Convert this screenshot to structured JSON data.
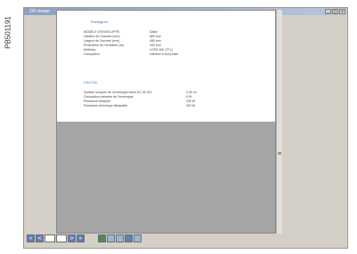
{
  "caption": {
    "code": "PB501191"
  },
  "window": {
    "title": "OS viewer",
    "controls": [
      "_",
      "□",
      "×"
    ]
  },
  "document": {
    "section1": {
      "title": "Prestigium",
      "rows": [
        {
          "label": "MODÈLE D'ENVELOPPE",
          "value": "Sable"
        },
        {
          "label": "Hauteur de l'ouvrant (mm)",
          "value": "860 mm"
        },
        {
          "label": "Largeur de l'ouvrant (mm)",
          "value": "480 mm"
        },
        {
          "label": "Profondeur de l'armature (m)",
          "value": "340 mm"
        },
        {
          "label": "Matériau",
          "value": "LV301 MU (TFL)"
        },
        {
          "label": "Occupation",
          "value": "Intérieur à tout poste"
        }
      ]
    },
    "section2": {
      "title": "CALCUL",
      "rows": [
        {
          "label": "Surface occupée de l'enveloppe selon EC 62 001",
          "value": "0,30 m²"
        },
        {
          "label": "Occupation présente de l'enveloppe",
          "value": "0 W"
        },
        {
          "label": "Puissance dissipée",
          "value": "150 W"
        },
        {
          "label": "Puissance thermique dissipable",
          "value": "260 W"
        }
      ]
    }
  },
  "toolbar": {
    "nav": {
      "first": "«",
      "prev": "<",
      "next": ">",
      "last": "»"
    },
    "tools": [
      "save-icon",
      "print-icon",
      "export-icon",
      "disk-icon",
      "close-icon"
    ]
  }
}
